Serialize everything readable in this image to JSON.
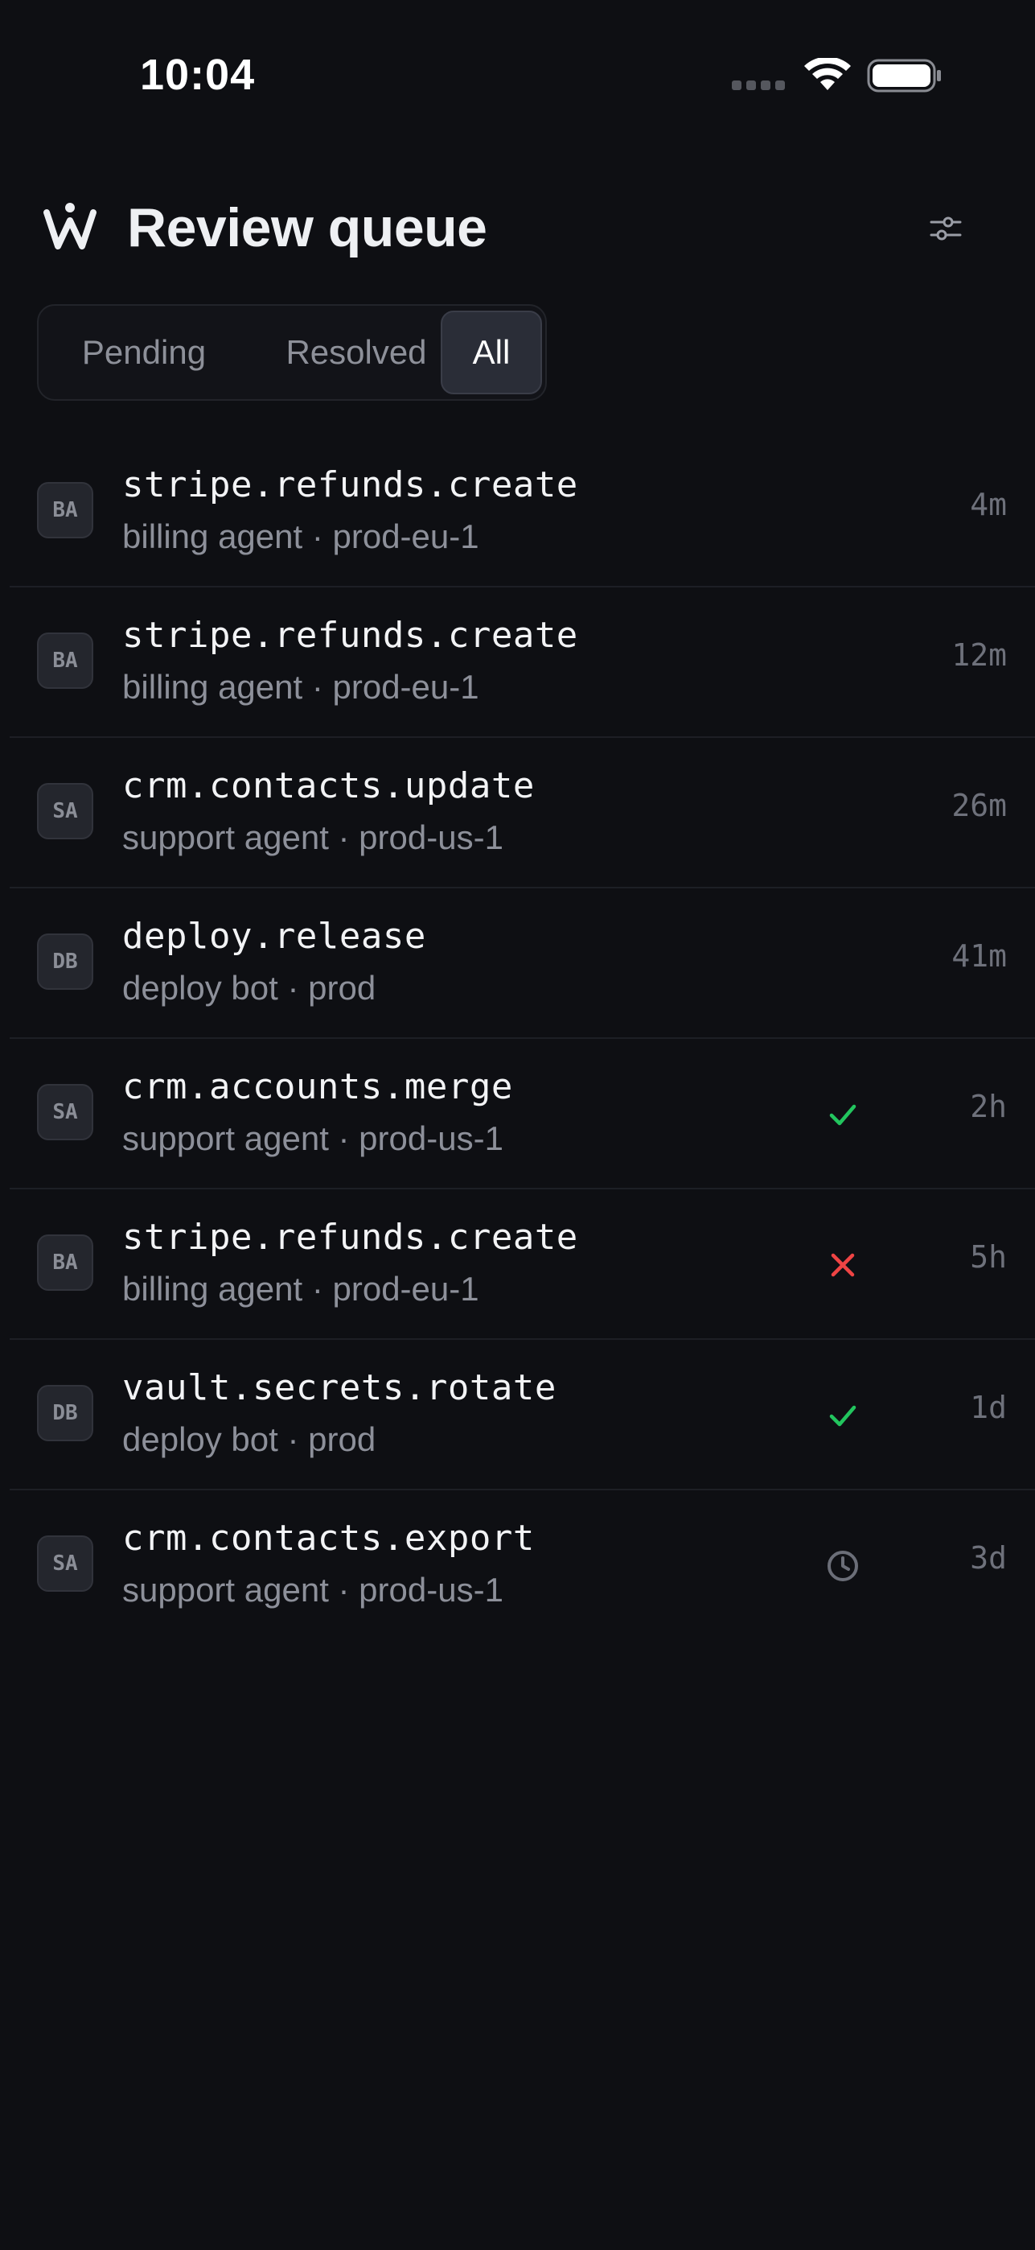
{
  "status_bar": {
    "time": "10:04"
  },
  "header": {
    "title": "Review queue",
    "logo_icon": "w-logo-icon",
    "filter_icon": "sliders-icon"
  },
  "tabs": [
    {
      "label": "Pending",
      "selected": false
    },
    {
      "label": "Resolved",
      "selected": false
    },
    {
      "label": "All",
      "selected": true
    }
  ],
  "colors": {
    "background": "#0e0f13",
    "approved": "#22c55e",
    "rejected": "#ef4444",
    "pending": "#6b6e78"
  },
  "items": [
    {
      "avatar": "BA",
      "action": "stripe.refunds.create",
      "meta": "billing agent · prod-eu-1",
      "status": "none",
      "time": "4m"
    },
    {
      "avatar": "BA",
      "action": "stripe.refunds.create",
      "meta": "billing agent · prod-eu-1",
      "status": "none",
      "time": "12m"
    },
    {
      "avatar": "SA",
      "action": "crm.contacts.update",
      "meta": "support agent · prod-us-1",
      "status": "none",
      "time": "26m"
    },
    {
      "avatar": "DB",
      "action": "deploy.release",
      "meta": "deploy bot · prod",
      "status": "none",
      "time": "41m"
    },
    {
      "avatar": "SA",
      "action": "crm.accounts.merge",
      "meta": "support agent · prod-us-1",
      "status": "check-icon",
      "time": "2h"
    },
    {
      "avatar": "BA",
      "action": "stripe.refunds.create",
      "meta": "billing agent · prod-eu-1",
      "status": "x-icon",
      "time": "5h"
    },
    {
      "avatar": "DB",
      "action": "vault.secrets.rotate",
      "meta": "deploy bot · prod",
      "status": "check-icon",
      "time": "1d"
    },
    {
      "avatar": "SA",
      "action": "crm.contacts.export",
      "meta": "support agent · prod-us-1",
      "status": "clock-icon",
      "time": "3d"
    }
  ]
}
